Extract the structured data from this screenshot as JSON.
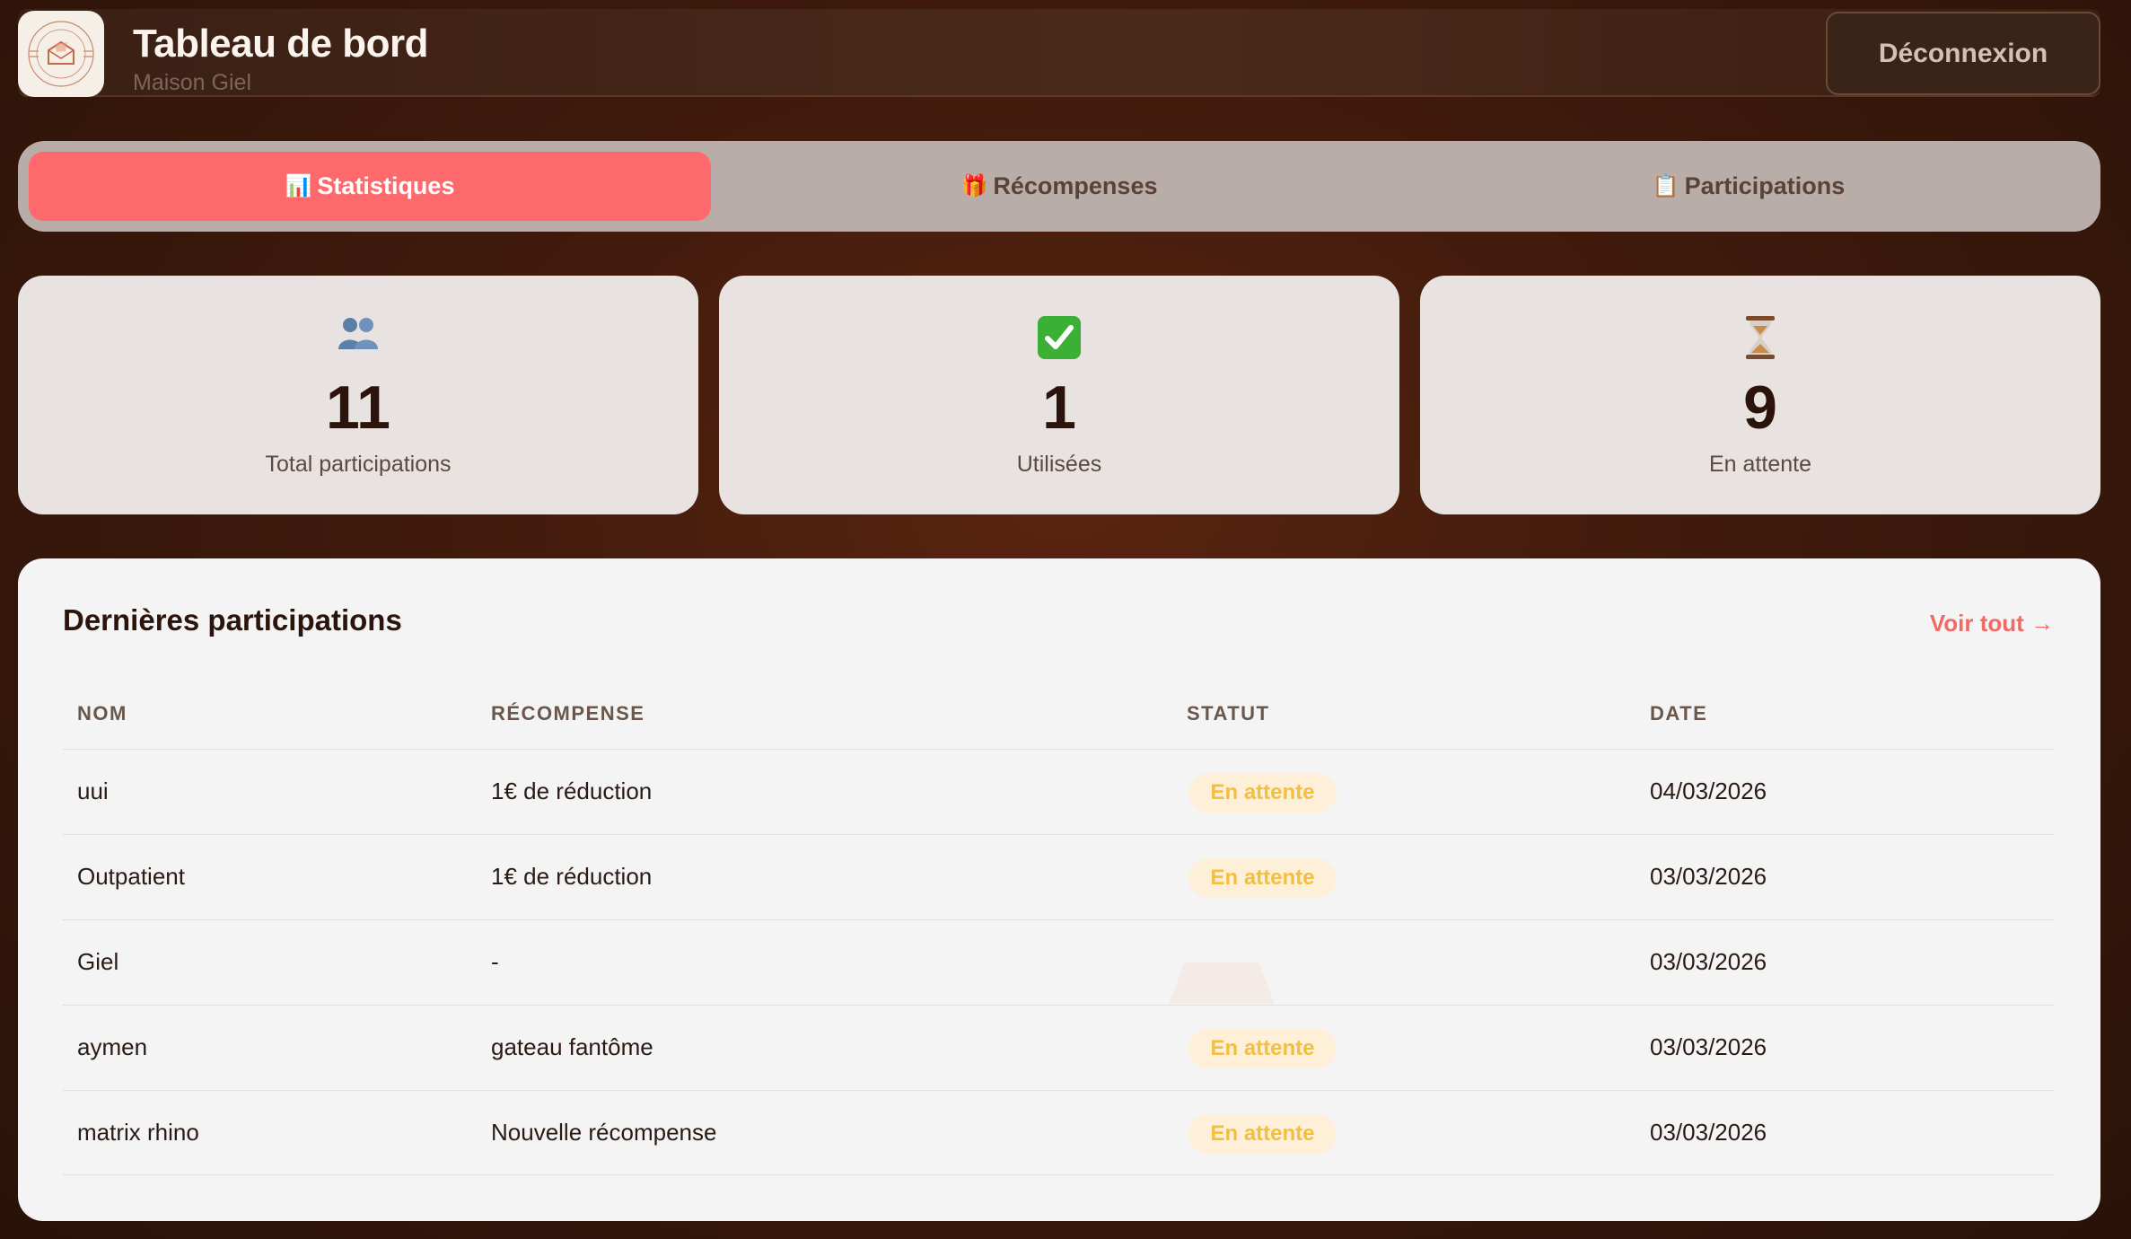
{
  "header": {
    "title": "Tableau de bord",
    "subtitle": "Maison Giel",
    "logout_label": "Déconnexion"
  },
  "tabs": [
    {
      "icon": "📊",
      "label": "Statistiques",
      "active": true
    },
    {
      "icon": "🎁",
      "label": "Récompenses",
      "active": false
    },
    {
      "icon": "📋",
      "label": "Participations",
      "active": false
    }
  ],
  "stats": [
    {
      "icon": "people-icon",
      "value": "11",
      "label": "Total participations"
    },
    {
      "icon": "check-icon",
      "value": "1",
      "label": "Utilisées"
    },
    {
      "icon": "hourglass-icon",
      "value": "9",
      "label": "En attente"
    }
  ],
  "recent": {
    "title": "Dernières participations",
    "see_all": "Voir tout →",
    "columns": [
      "NOM",
      "RÉCOMPENSE",
      "STATUT",
      "DATE"
    ],
    "rows": [
      {
        "name": "uui",
        "reward": "1€ de réduction",
        "status": "En attente",
        "date": "04/03/2026"
      },
      {
        "name": "Outpatient",
        "reward": "1€ de réduction",
        "status": "En attente",
        "date": "03/03/2026"
      },
      {
        "name": "Giel",
        "reward": "-",
        "status": "",
        "date": "03/03/2026"
      },
      {
        "name": "aymen",
        "reward": "gateau fantôme",
        "status": "En attente",
        "date": "03/03/2026"
      },
      {
        "name": "matrix rhino",
        "reward": "Nouvelle récompense",
        "status": "En attente",
        "date": "03/03/2026"
      }
    ]
  },
  "colors": {
    "accent": "#fe6a6c",
    "pending_text": "#f3bf43",
    "pending_bg": "#fdefd8"
  }
}
